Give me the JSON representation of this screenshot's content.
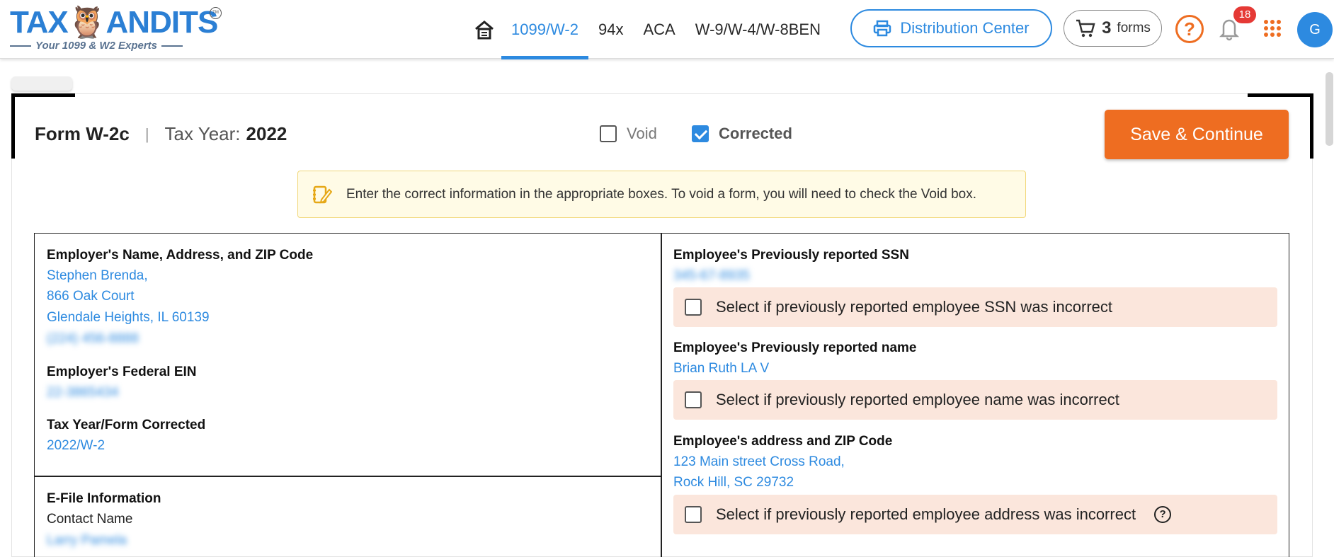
{
  "header": {
    "logo": {
      "brand_text": "TAXBANDITS",
      "tagline": "Your 1099 & W2 Experts",
      "tm": "TM"
    },
    "nav": {
      "home_icon": "home-icon",
      "items": [
        {
          "label": "1099/W-2",
          "active": true
        },
        {
          "label": "94x",
          "active": false
        },
        {
          "label": "ACA",
          "active": false
        },
        {
          "label": "W-9/W-4/W-8BEN",
          "active": false
        }
      ]
    },
    "distribution_center": {
      "label": "Distribution Center",
      "icon": "printer-icon"
    },
    "cart": {
      "count": "3",
      "label": "forms",
      "icon": "cart-icon"
    },
    "help_icon": "help-icon",
    "notifications": {
      "count": "18",
      "icon": "bell-icon"
    },
    "apps_icon": "apps-grid-icon",
    "avatar": {
      "initial": "G"
    }
  },
  "form_header": {
    "form_name": "Form W-2c",
    "separator": "|",
    "tax_year_label": "Tax Year:",
    "tax_year_value": "2022",
    "void": {
      "label": "Void",
      "checked": false
    },
    "corrected": {
      "label": "Corrected",
      "checked": true
    },
    "save_button": "Save & Continue"
  },
  "notice": {
    "icon": "note-edit-icon",
    "text": "Enter the correct information in the appropriate boxes. To void a form, you will need to check the Void box."
  },
  "employer": {
    "name_label": "Employer's Name, Address, and ZIP Code",
    "name": "Stephen Brenda,",
    "address1": "866 Oak Court",
    "address2": "Glendale Heights, IL 60139",
    "phone": "(224) 456-8888",
    "ein_label": "Employer's Federal EIN",
    "ein": "22-3865434",
    "tax_year_form_label": "Tax Year/Form Corrected",
    "tax_year_form": "2022/W-2"
  },
  "efile": {
    "heading": "E-File Information",
    "contact_label": "Contact Name",
    "contact_value": "Larry Pamela"
  },
  "employee": {
    "ssn_label": "Employee's Previously reported SSN",
    "ssn": "345-67-8935",
    "ssn_incorrect": "Select if previously reported employee SSN was incorrect",
    "name_label": "Employee's Previously reported name",
    "name": "Brian Ruth LA V",
    "name_incorrect": "Select if previously reported employee name was incorrect",
    "address_label": "Employee's address and ZIP Code",
    "address1": "123 Main street Cross Road,",
    "address2": "Rock Hill, SC 29732",
    "address_incorrect": "Select if previously reported employee address was incorrect"
  },
  "colors": {
    "primary": "#2d8ae0",
    "accent": "#ee6d21",
    "notice_bg": "#fffbe6",
    "incorrect_bg": "#fbe6dc"
  }
}
